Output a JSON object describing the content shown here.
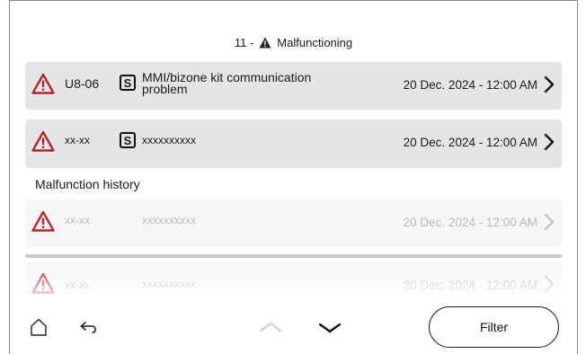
{
  "header": {
    "prefix": "11 -",
    "title": "Malfunctioning",
    "icon": "warning-triangle-icon"
  },
  "active_faults": [
    {
      "code": "U8-06",
      "source_badge": "S",
      "description": "MMI/bizone kit communication problem",
      "timestamp": "20 Dec. 2024 - 12:00 AM"
    },
    {
      "code": "xx-xx",
      "source_badge": "S",
      "description": "xxxxxxxxxx",
      "timestamp": "20 Dec. 2024 - 12:00 AM"
    }
  ],
  "history": {
    "label": "Malfunction history",
    "items": [
      {
        "code": "xx-xx",
        "description": "xxxxxxxxxx",
        "timestamp": "20 Dec. 2024 - 12:00 AM"
      },
      {
        "code": "xx-xx",
        "description": "xxxxxxxxxx",
        "timestamp": "20 Dec. 2024 - 12:00 AM"
      }
    ]
  },
  "nav": {
    "home_icon": "home-icon",
    "back_icon": "back-arrow-icon",
    "up_icon": "chevron-up-icon",
    "down_icon": "chevron-down-icon",
    "filter_label": "Filter"
  },
  "colors": {
    "warning_red": "#b5252f",
    "row_bg": "#e4e5e5",
    "faded_row_bg": "#f5f6f6",
    "faded_text": "#b9b9b9"
  }
}
